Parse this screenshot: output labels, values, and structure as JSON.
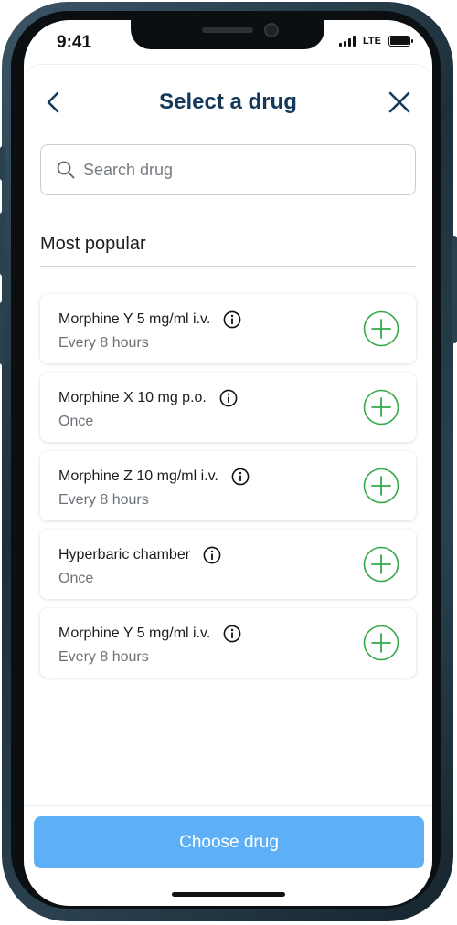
{
  "status_bar": {
    "time": "9:41",
    "network": "LTE"
  },
  "header": {
    "title": "Select a drug"
  },
  "search": {
    "placeholder": "Search drug",
    "value": ""
  },
  "section": {
    "title": "Most popular"
  },
  "drugs": [
    {
      "name": "Morphine Y 5 mg/ml i.v.",
      "frequency": "Every 8 hours"
    },
    {
      "name": "Morphine X 10 mg p.o.",
      "frequency": "Once"
    },
    {
      "name": "Morphine Z 10 mg/ml i.v.",
      "frequency": "Every 8 hours"
    },
    {
      "name": "Hyperbaric chamber",
      "frequency": "Once"
    },
    {
      "name": "Morphine Y 5 mg/ml i.v.",
      "frequency": "Every 8 hours"
    }
  ],
  "footer": {
    "button_label": "Choose drug"
  },
  "colors": {
    "title": "#14395b",
    "accent_green": "#36a84a",
    "button_primary_disabled": "#5eb0f6",
    "icon_dark": "#14395b"
  },
  "icons": {
    "back": "chevron-left-icon",
    "close": "close-icon",
    "search": "search-icon",
    "info": "info-icon",
    "add": "plus-circle-icon"
  }
}
